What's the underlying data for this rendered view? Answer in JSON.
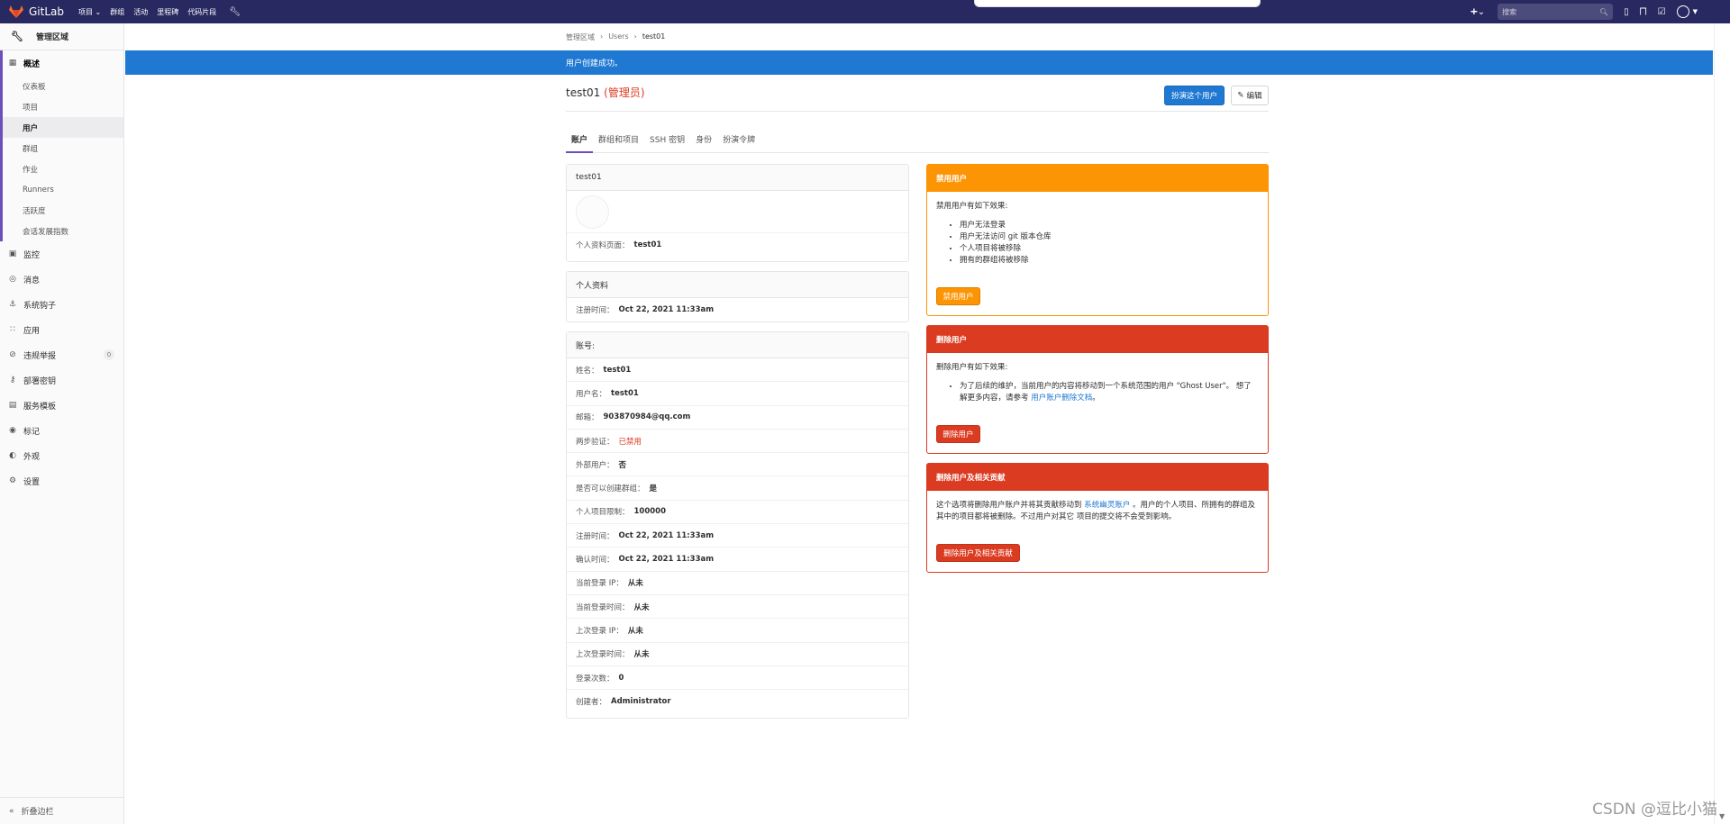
{
  "topbar": {
    "brand": "GitLab",
    "menu": [
      "项目 ⌄",
      "群组",
      "活动",
      "里程碑",
      "代码片段"
    ],
    "search_placeholder": "搜索",
    "colors": {
      "nav_bg": "#292961"
    }
  },
  "sidebar": {
    "header": "管理区域",
    "overview_label": "概述",
    "overview_items": [
      "仪表板",
      "项目",
      "用户",
      "群组",
      "作业",
      "Runners",
      "活跃度",
      "会话发展指数"
    ],
    "items": [
      {
        "label": "监控",
        "icon": "monitor-icon"
      },
      {
        "label": "消息",
        "icon": "broadcast-icon"
      },
      {
        "label": "系统钩子",
        "icon": "hook-icon"
      },
      {
        "label": "应用",
        "icon": "apps-icon"
      },
      {
        "label": "违规举报",
        "icon": "report-icon",
        "badge": "0"
      },
      {
        "label": "部署密钥",
        "icon": "key-icon"
      },
      {
        "label": "服务模板",
        "icon": "template-icon"
      },
      {
        "label": "标记",
        "icon": "label-icon"
      },
      {
        "label": "外观",
        "icon": "appearance-icon"
      },
      {
        "label": "设置",
        "icon": "settings-icon"
      }
    ],
    "collapse": "折叠边栏"
  },
  "breadcrumb": [
    "管理区域",
    "Users",
    "test01"
  ],
  "flash": "用户创建成功。",
  "user": {
    "name": "test01",
    "role": "(管理员)"
  },
  "buttons": {
    "impersonate": "扮演这个用户",
    "edit": "编辑"
  },
  "tabs": [
    "账户",
    "群组和项目",
    "SSH 密钥",
    "身份",
    "扮演令牌"
  ],
  "profile_card": {
    "title": "test01",
    "profile_page_label": "个人资料页面：",
    "profile_page_value": "test01"
  },
  "personal_card": {
    "title": "个人资料",
    "member_since_label": "注册时间：",
    "member_since_value": "Oct 22, 2021 11:33am"
  },
  "account_card": {
    "title": "账号:",
    "rows": [
      {
        "label": "姓名：",
        "value": "test01"
      },
      {
        "label": "用户名：",
        "value": "test01"
      },
      {
        "label": "邮箱：",
        "value": "903870984@qq.com"
      },
      {
        "label": "两步验证：",
        "value": "已禁用",
        "status": "danger"
      },
      {
        "label": "外部用户：",
        "value": "否"
      },
      {
        "label": "是否可以创建群组：",
        "value": "是"
      },
      {
        "label": "个人项目限制：",
        "value": "100000"
      },
      {
        "label": "注册时间：",
        "value": "Oct 22, 2021 11:33am"
      },
      {
        "label": "确认时间：",
        "value": "Oct 22, 2021 11:33am"
      },
      {
        "label": "当前登录 IP：",
        "value": "从未"
      },
      {
        "label": "当前登录时间：",
        "value": "从未"
      },
      {
        "label": "上次登录 IP：",
        "value": "从未"
      },
      {
        "label": "上次登录时间：",
        "value": "从未"
      },
      {
        "label": "登录次数：",
        "value": "0"
      },
      {
        "label": "创建者：",
        "value": "Administrator"
      }
    ]
  },
  "block_card": {
    "title": "禁用用户",
    "intro": "禁用用户有如下效果:",
    "effects": [
      "用户无法登录",
      "用户无法访问 git 版本仓库",
      "个人项目将被移除",
      "拥有的群组将被移除"
    ],
    "button": "禁用用户"
  },
  "delete_card": {
    "title": "删除用户",
    "intro": "删除用户有如下效果:",
    "effect_text": "为了后续的维护，当前用户的内容将移动到一个系统范围的用户 \"Ghost User\"。 想了解更多内容，请参考",
    "effect_link": "用户账户删除文档",
    "effect_end": "。",
    "button": "删除用户"
  },
  "delete_contrib_card": {
    "title": "删除用户及相关贡献",
    "text_pre": "这个选项将删除用户账户并将其贡献移动到",
    "text_link": "系统幽灵账户",
    "text_post": "。用户的个人项目、所拥有的群组及其中的项目都将被删除。不过用户对其它 项目的提交将不会受到影响。",
    "button": "删除用户及相关贡献"
  },
  "watermark": "CSDN @逗比小猫"
}
